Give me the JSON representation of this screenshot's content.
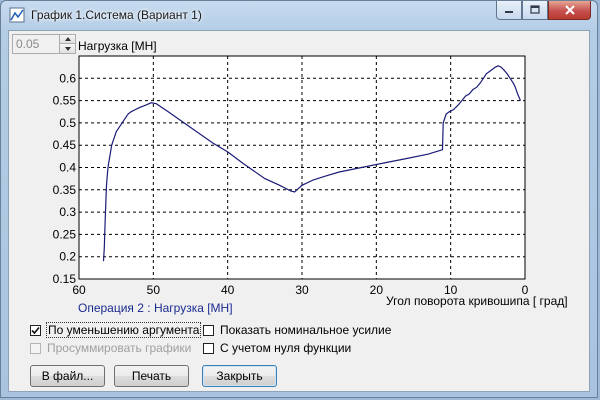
{
  "window": {
    "title": "График 1.Система (Вариант 1)",
    "icon": "app-icon"
  },
  "spinner": {
    "value": "0.05"
  },
  "chart_data": {
    "type": "line",
    "ylabel": "Нагрузка [МН]",
    "xlabel": "Угол поворота кривошипа [ град]",
    "series_caption": "Операция 2 : Нагрузка [МН]",
    "xlim": [
      60,
      0
    ],
    "ylim": [
      0.15,
      0.65
    ],
    "x_ticks": [
      "60",
      "50",
      "40",
      "30",
      "20",
      "10",
      "0"
    ],
    "y_ticks": [
      "0.15",
      "0.2",
      "0.25",
      "0.3",
      "0.35",
      "0.4",
      "0.45",
      "0.5",
      "0.55",
      "0.6"
    ],
    "grid": true,
    "line_color": "#1c1c78",
    "series": [
      {
        "x": [
          56.7,
          56.6,
          56.5,
          56.4,
          56.3,
          56.2,
          56.1,
          56.0,
          55.8,
          55.6,
          55.4,
          55.2,
          55.0,
          54.6,
          54.2,
          53.8,
          53.4,
          53.0,
          52.4,
          51.8,
          51.0,
          50.3,
          49.6,
          48.0,
          45.0,
          42.0,
          40.0,
          38.0,
          35.0,
          33.0,
          31.5,
          31.0,
          30.0,
          28.5,
          27.0,
          25.0,
          22.0,
          19.0,
          16.0,
          13.0,
          11.1,
          11.0,
          10.6,
          10.2,
          9.6,
          9.0,
          8.5,
          8.0,
          7.5,
          7.0,
          6.5,
          6.0,
          5.6,
          5.2,
          4.8,
          4.4,
          4.0,
          3.6,
          3.2,
          2.8,
          2.4,
          2.0,
          1.6,
          1.3,
          1.0,
          0.6
        ],
        "y": [
          0.19,
          0.22,
          0.27,
          0.32,
          0.36,
          0.38,
          0.4,
          0.41,
          0.43,
          0.45,
          0.46,
          0.47,
          0.48,
          0.49,
          0.5,
          0.51,
          0.52,
          0.525,
          0.53,
          0.535,
          0.54,
          0.545,
          0.543,
          0.525,
          0.49,
          0.455,
          0.435,
          0.41,
          0.375,
          0.36,
          0.347,
          0.345,
          0.36,
          0.372,
          0.38,
          0.39,
          0.4,
          0.41,
          0.42,
          0.43,
          0.44,
          0.5,
          0.52,
          0.525,
          0.53,
          0.54,
          0.55,
          0.56,
          0.565,
          0.575,
          0.58,
          0.59,
          0.6,
          0.61,
          0.615,
          0.62,
          0.625,
          0.628,
          0.625,
          0.618,
          0.61,
          0.6,
          0.59,
          0.58,
          0.565,
          0.55
        ]
      }
    ]
  },
  "options": {
    "decreasing_arg": {
      "label": "По уменьшению аргумента",
      "checked": true
    },
    "sum_graphs": {
      "label": "Просуммировать графики",
      "checked": false,
      "disabled": true
    },
    "nominal_force": {
      "label": "Показать номинальное усилие",
      "checked": false
    },
    "zero_function": {
      "label": "С учетом нуля функции",
      "checked": false
    }
  },
  "buttons": {
    "to_file": "В файл...",
    "print": "Печать",
    "close": "Закрыть"
  }
}
